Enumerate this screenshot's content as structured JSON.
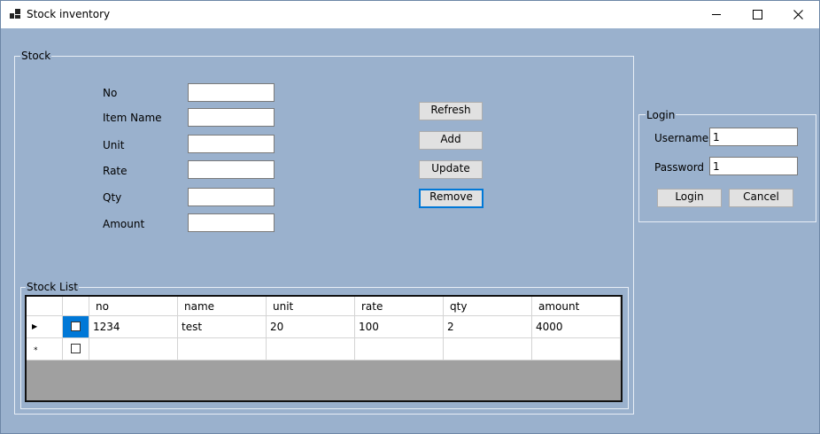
{
  "window": {
    "title": "Stock inventory",
    "minimize_glyph": "—",
    "maximize_glyph": "☐",
    "close_glyph": "✕"
  },
  "stock": {
    "group_title": "Stock",
    "fields": {
      "no": {
        "label": "No",
        "value": ""
      },
      "item_name": {
        "label": "Item Name",
        "value": ""
      },
      "unit": {
        "label": "Unit",
        "value": ""
      },
      "rate": {
        "label": "Rate",
        "value": ""
      },
      "qty": {
        "label": "Qty",
        "value": ""
      },
      "amount": {
        "label": "Amount",
        "value": ""
      }
    },
    "buttons": {
      "refresh": "Refresh",
      "add": "Add",
      "update": "Update",
      "remove": "Remove"
    }
  },
  "stock_list": {
    "group_title": "Stock List",
    "columns": [
      "no",
      "name",
      "unit",
      "rate",
      "qty",
      "amount"
    ],
    "rows": [
      {
        "checked": false,
        "no": "1234",
        "name": "test",
        "unit": "20",
        "rate": "100",
        "qty": "2",
        "amount": "4000"
      }
    ],
    "current_row_glyph": "▶",
    "new_row_glyph": "*"
  },
  "login": {
    "group_title": "Login",
    "username_label": "Username",
    "username_value": "1",
    "password_label": "Password",
    "password_value": "1",
    "login_button": "Login",
    "cancel_button": "Cancel"
  },
  "colors": {
    "form_background": "#9ab1cd",
    "grid_background": "#a0a0a0",
    "selection_blue": "#0078d7"
  }
}
